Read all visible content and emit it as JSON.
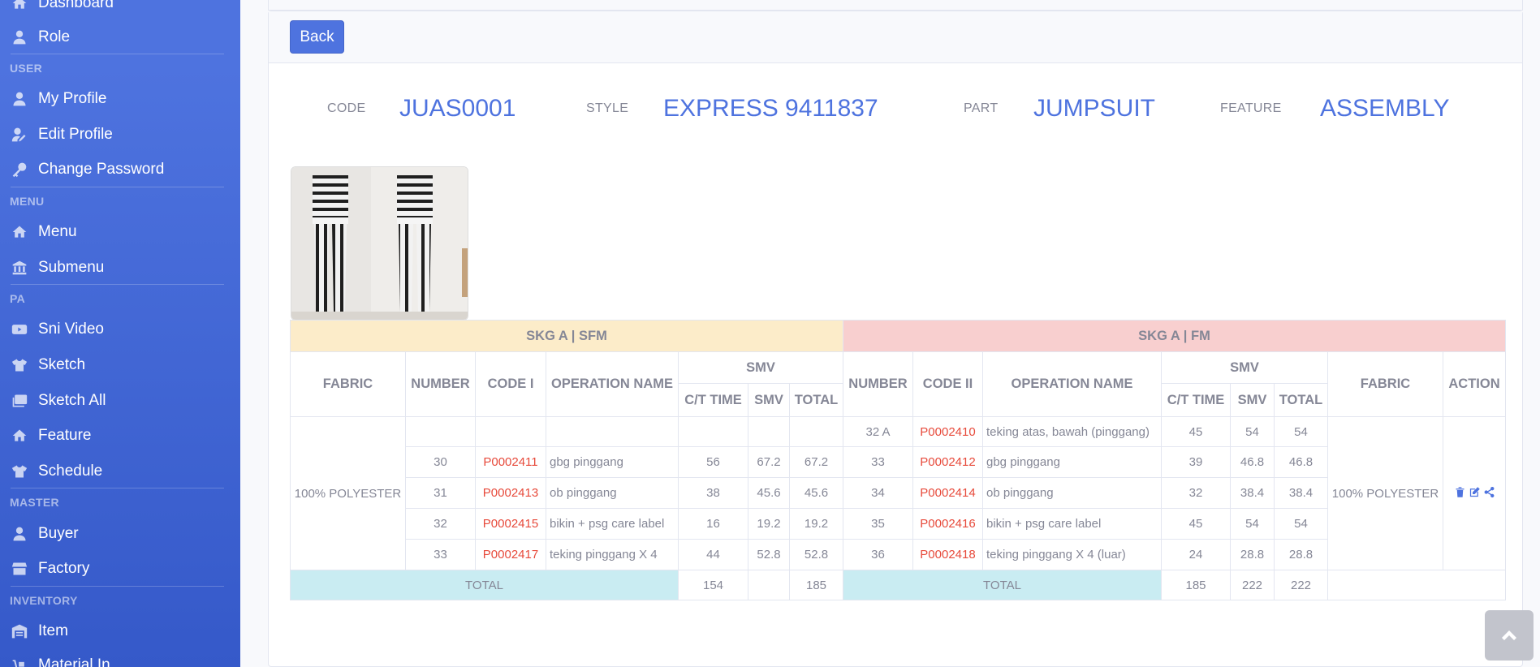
{
  "sidebar": {
    "items": [
      {
        "label": "Dashboard",
        "icon": "home-icon"
      },
      {
        "label": "Role",
        "icon": "user-tie-icon"
      },
      {
        "label": "My Profile",
        "icon": "user-icon"
      },
      {
        "label": "Edit Profile",
        "icon": "user-edit-icon"
      },
      {
        "label": "Change Password",
        "icon": "key-icon"
      },
      {
        "label": "Menu",
        "icon": "home-icon"
      },
      {
        "label": "Submenu",
        "icon": "university-icon"
      },
      {
        "label": "Sni Video",
        "icon": "video-icon"
      },
      {
        "label": "Sketch",
        "icon": "tshirt-icon"
      },
      {
        "label": "Sketch All",
        "icon": "images-icon"
      },
      {
        "label": "Feature",
        "icon": "home-icon"
      },
      {
        "label": "Schedule",
        "icon": "tshirt-icon"
      },
      {
        "label": "Buyer",
        "icon": "user-tie-icon"
      },
      {
        "label": "Factory",
        "icon": "store-icon"
      },
      {
        "label": "Item",
        "icon": "warehouse-icon"
      },
      {
        "label": "Material In",
        "icon": "dolly-icon"
      }
    ],
    "headings": [
      "USER",
      "MENU",
      "PA",
      "MASTER",
      "INVENTORY"
    ]
  },
  "header": {
    "back_label": "Back"
  },
  "info": {
    "code_label": "CODE",
    "code_value": "JUAS0001",
    "style_label": "STYLE",
    "style_value": "EXPRESS 9411837",
    "part_label": "PART",
    "part_value": "JUMPSUIT",
    "feature_label": "FEATURE",
    "feature_value": "ASSEMBLY"
  },
  "table": {
    "group_sfm": "SKG A | SFM",
    "group_fm": "SKG A | FM",
    "headers": {
      "fabric": "FABRIC",
      "number": "NUMBER",
      "code1": "CODE I",
      "opname": "OPERATION NAME",
      "smv_group": "SMV",
      "ct_time": "C/T TIME",
      "smv": "SMV",
      "total": "TOTAL",
      "code2": "CODE II",
      "action": "ACTION"
    },
    "fabric_left": "100% POLYESTER",
    "fabric_right": "100% POLYESTER",
    "rows": [
      {
        "l_num": "",
        "l_code": "",
        "l_op": "",
        "l_ct": "",
        "l_smv": "",
        "l_tot": "",
        "r_num": "32 A",
        "r_code": "P0002410",
        "r_op": "teking atas, bawah (pinggang)",
        "r_ct": "45",
        "r_smv": "54",
        "r_tot": "54"
      },
      {
        "l_num": "30",
        "l_code": "P0002411",
        "l_op": "gbg pinggang",
        "l_ct": "56",
        "l_smv": "67.2",
        "l_tot": "67.2",
        "r_num": "33",
        "r_code": "P0002412",
        "r_op": "gbg pinggang",
        "r_ct": "39",
        "r_smv": "46.8",
        "r_tot": "46.8"
      },
      {
        "l_num": "31",
        "l_code": "P0002413",
        "l_op": "ob pinggang",
        "l_ct": "38",
        "l_smv": "45.6",
        "l_tot": "45.6",
        "r_num": "34",
        "r_code": "P0002414",
        "r_op": "ob pinggang",
        "r_ct": "32",
        "r_smv": "38.4",
        "r_tot": "38.4"
      },
      {
        "l_num": "32",
        "l_code": "P0002415",
        "l_op": "bikin + psg care label",
        "l_ct": "16",
        "l_smv": "19.2",
        "l_tot": "19.2",
        "r_num": "35",
        "r_code": "P0002416",
        "r_op": "bikin + psg care label",
        "r_ct": "45",
        "r_smv": "54",
        "r_tot": "54"
      },
      {
        "l_num": "33",
        "l_code": "P0002417",
        "l_op": "teking pinggang X 4",
        "l_ct": "44",
        "l_smv": "52.8",
        "l_tot": "52.8",
        "r_num": "36",
        "r_code": "P0002418",
        "r_op": "teking pinggang X 4 (luar)",
        "r_ct": "24",
        "r_smv": "28.8",
        "r_tot": "28.8"
      }
    ],
    "totals": {
      "label_left": "TOTAL",
      "l_ct": "154",
      "l_smv": "",
      "l_tot": "185",
      "label_right": "TOTAL",
      "r_ct": "185",
      "r_smv": "222",
      "r_tot": "222"
    }
  },
  "colors": {
    "primary": "#4e73df",
    "code_red": "#e74a3b",
    "sfm_bg": "#fcecc9",
    "fm_bg": "#f8cfcf",
    "total_bg": "#c9ecf2"
  }
}
